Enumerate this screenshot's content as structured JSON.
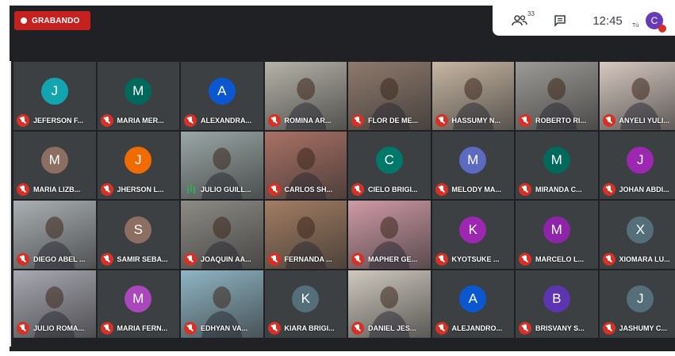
{
  "recording": {
    "label": "GRABANDO"
  },
  "header": {
    "people_count": "33",
    "time": "12:45",
    "you_label": "Tú",
    "self_initial": "C",
    "self_color": "#673ab7"
  },
  "participants": [
    {
      "name": "JEFERSON F...",
      "initial": "J",
      "color": "#12a4af",
      "video": false
    },
    {
      "name": "MARIA MER...",
      "initial": "M",
      "color": "#00695c",
      "video": false
    },
    {
      "name": "ALEXANDRA...",
      "initial": "A",
      "color": "#0b57d0",
      "video": false
    },
    {
      "name": "ROMINA AR...",
      "video": true,
      "bg": "#b5b2a8"
    },
    {
      "name": "FLOR DE ME...",
      "video": true,
      "bg": "#8e7a6d"
    },
    {
      "name": "HASSUMY N...",
      "video": true,
      "bg": "#c7b6a3"
    },
    {
      "name": "ROBERTO RI...",
      "video": true,
      "bg": "#9c9a95"
    },
    {
      "name": "ANYELI YULI...",
      "video": true,
      "bg": "#d6c8c0"
    },
    {
      "name": "MARIA LIZB...",
      "initial": "M",
      "color": "#8d6e63",
      "video": false
    },
    {
      "name": "JHERSON L...",
      "initial": "J",
      "color": "#f06c00",
      "video": false
    },
    {
      "name": "JULIO GUILL...",
      "video": true,
      "bg": "#9aa7a6",
      "speaking": true
    },
    {
      "name": "CARLOS SH...",
      "video": true,
      "bg": "#a97165"
    },
    {
      "name": "CIELO BRIGI...",
      "initial": "C",
      "color": "#00796b",
      "video": false
    },
    {
      "name": "MELODY MA...",
      "initial": "M",
      "color": "#5c6bc0",
      "video": false
    },
    {
      "name": "MIRANDA C...",
      "initial": "M",
      "color": "#00695c",
      "video": false
    },
    {
      "name": "JOHAN ABDI...",
      "initial": "J",
      "color": "#9c27b0",
      "video": false
    },
    {
      "name": "DIEGO ABEL ...",
      "video": true,
      "bg": "#aab0b3"
    },
    {
      "name": "SAMIR SEBA...",
      "initial": "S",
      "color": "#8d6e63",
      "video": false
    },
    {
      "name": "JOAQUIN AA...",
      "video": true,
      "bg": "#8d8b85"
    },
    {
      "name": "FERNANDA ...",
      "video": true,
      "bg": "#a27d63"
    },
    {
      "name": "MAPHER GE...",
      "video": true,
      "bg": "#cf9aa6"
    },
    {
      "name": "KYOTSUKE ...",
      "initial": "K",
      "color": "#9c27b0",
      "video": false
    },
    {
      "name": "MARCELO L...",
      "initial": "M",
      "color": "#8e24aa",
      "video": false
    },
    {
      "name": "XIOMARA LU...",
      "initial": "X",
      "color": "#546e7a",
      "video": false
    },
    {
      "name": "JULIO ROMA...",
      "video": true,
      "bg": "#a8a9b2"
    },
    {
      "name": "MARIA FERN...",
      "initial": "M",
      "color": "#ab47bc",
      "video": false
    },
    {
      "name": "EDHYAN VA...",
      "video": true,
      "bg": "#8fb5c4"
    },
    {
      "name": "KIARA BRIGI...",
      "initial": "K",
      "color": "#546e7a",
      "video": false
    },
    {
      "name": "DANIEL JES...",
      "video": true,
      "bg": "#cfc9bf"
    },
    {
      "name": "ALEJANDRO...",
      "initial": "A",
      "color": "#0b57d0",
      "video": false
    },
    {
      "name": "BRISVANY S...",
      "initial": "B",
      "color": "#5e35b1",
      "video": false
    },
    {
      "name": "JASHUMY C...",
      "initial": "J",
      "color": "#546e7a",
      "video": false
    }
  ]
}
